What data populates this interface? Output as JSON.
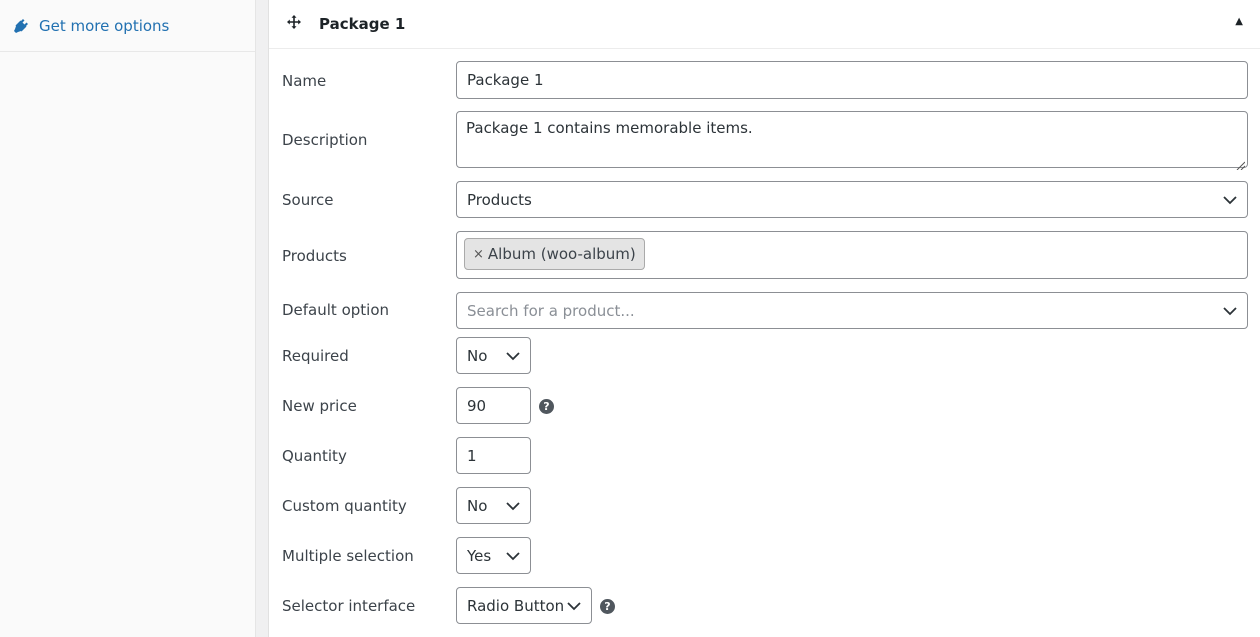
{
  "sidebar": {
    "items": [
      {
        "label": "Get more options",
        "icon": "plug-icon"
      }
    ]
  },
  "panel": {
    "title": "Package 1",
    "fields": {
      "name": {
        "label": "Name",
        "value": "Package 1"
      },
      "description": {
        "label": "Description",
        "value": "Package 1 contains memorable items."
      },
      "source": {
        "label": "Source",
        "value": "Products"
      },
      "products": {
        "label": "Products",
        "chips": [
          "Album (woo-album)"
        ]
      },
      "default_option": {
        "label": "Default option",
        "placeholder": "Search for a product..."
      },
      "required": {
        "label": "Required",
        "value": "No"
      },
      "new_price": {
        "label": "New price",
        "value": "90"
      },
      "quantity": {
        "label": "Quantity",
        "value": "1"
      },
      "custom_quantity": {
        "label": "Custom quantity",
        "value": "No"
      },
      "multiple_selection": {
        "label": "Multiple selection",
        "value": "Yes"
      },
      "selector_interface": {
        "label": "Selector interface",
        "value": "Radio Button"
      }
    }
  },
  "colors": {
    "link": "#2271b1",
    "border": "#8c8f94",
    "text": "#3c434a"
  }
}
